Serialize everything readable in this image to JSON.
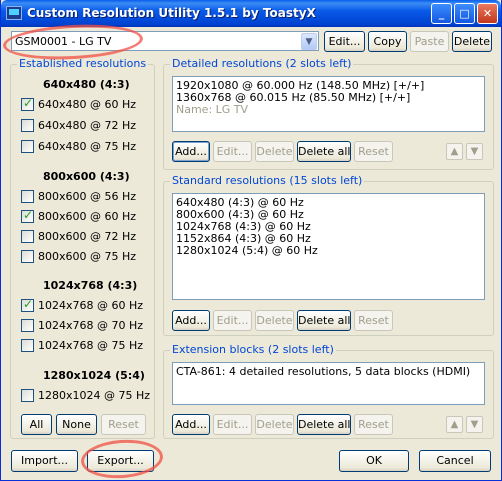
{
  "window": {
    "title": "Custom Resolution Utility 1.5.1 by ToastyX",
    "minimize_glyph": "_",
    "maximize_glyph": "□",
    "close_glyph": "✕"
  },
  "monitor_select": {
    "value": "GSM0001 - LG TV",
    "arrow": "▼"
  },
  "toolbar": {
    "edit": "Edit...",
    "copy": "Copy",
    "paste": "Paste",
    "delete": "Delete"
  },
  "established": {
    "title": "Established resolutions",
    "groups": [
      {
        "heading": "640x480 (4:3)",
        "items": [
          {
            "label": "640x480 @ 60 Hz",
            "checked": true
          },
          {
            "label": "640x480 @ 72 Hz",
            "checked": false
          },
          {
            "label": "640x480 @ 75 Hz",
            "checked": false
          }
        ]
      },
      {
        "heading": "800x600 (4:3)",
        "items": [
          {
            "label": "800x600 @ 56 Hz",
            "checked": false
          },
          {
            "label": "800x600 @ 60 Hz",
            "checked": true
          },
          {
            "label": "800x600 @ 72 Hz",
            "checked": false
          },
          {
            "label": "800x600 @ 75 Hz",
            "checked": false
          }
        ]
      },
      {
        "heading": "1024x768 (4:3)",
        "items": [
          {
            "label": "1024x768 @ 60 Hz",
            "checked": true
          },
          {
            "label": "1024x768 @ 70 Hz",
            "checked": false
          },
          {
            "label": "1024x768 @ 75 Hz",
            "checked": false
          }
        ]
      },
      {
        "heading": "1280x1024 (5:4)",
        "items": [
          {
            "label": "1280x1024 @ 75 Hz",
            "checked": false
          }
        ]
      }
    ],
    "buttons": {
      "all": "All",
      "none": "None",
      "reset": "Reset"
    }
  },
  "detailed": {
    "title": "Detailed resolutions (2 slots left)",
    "lines": [
      "1920x1080 @ 60.000 Hz (148.50 MHz) [+/+]",
      "1360x768 @ 60.015 Hz (85.50 MHz) [+/+]"
    ],
    "name_line": "Name: LG TV"
  },
  "standard": {
    "title": "Standard resolutions (15 slots left)",
    "lines": [
      "640x480 (4:3) @ 60 Hz",
      "800x600 (4:3) @ 60 Hz",
      "1024x768 (4:3) @ 60 Hz",
      "1152x864 (4:3) @ 60 Hz",
      "1280x1024 (5:4) @ 60 Hz"
    ]
  },
  "extension": {
    "title": "Extension blocks (2 slots left)",
    "lines": [
      "CTA-861: 4 detailed resolutions, 5 data blocks (HDMI)"
    ]
  },
  "panel_buttons": {
    "add": "Add...",
    "edit": "Edit...",
    "delete": "Delete",
    "delete_all": "Delete all",
    "reset": "Reset",
    "up": "▲",
    "down": "▼"
  },
  "footer": {
    "import": "Import...",
    "export": "Export...",
    "ok": "OK",
    "cancel": "Cancel"
  },
  "colors": {
    "titlebar": "#0a5aea",
    "group_label": "#0046d5",
    "annotation": "#f05046"
  }
}
